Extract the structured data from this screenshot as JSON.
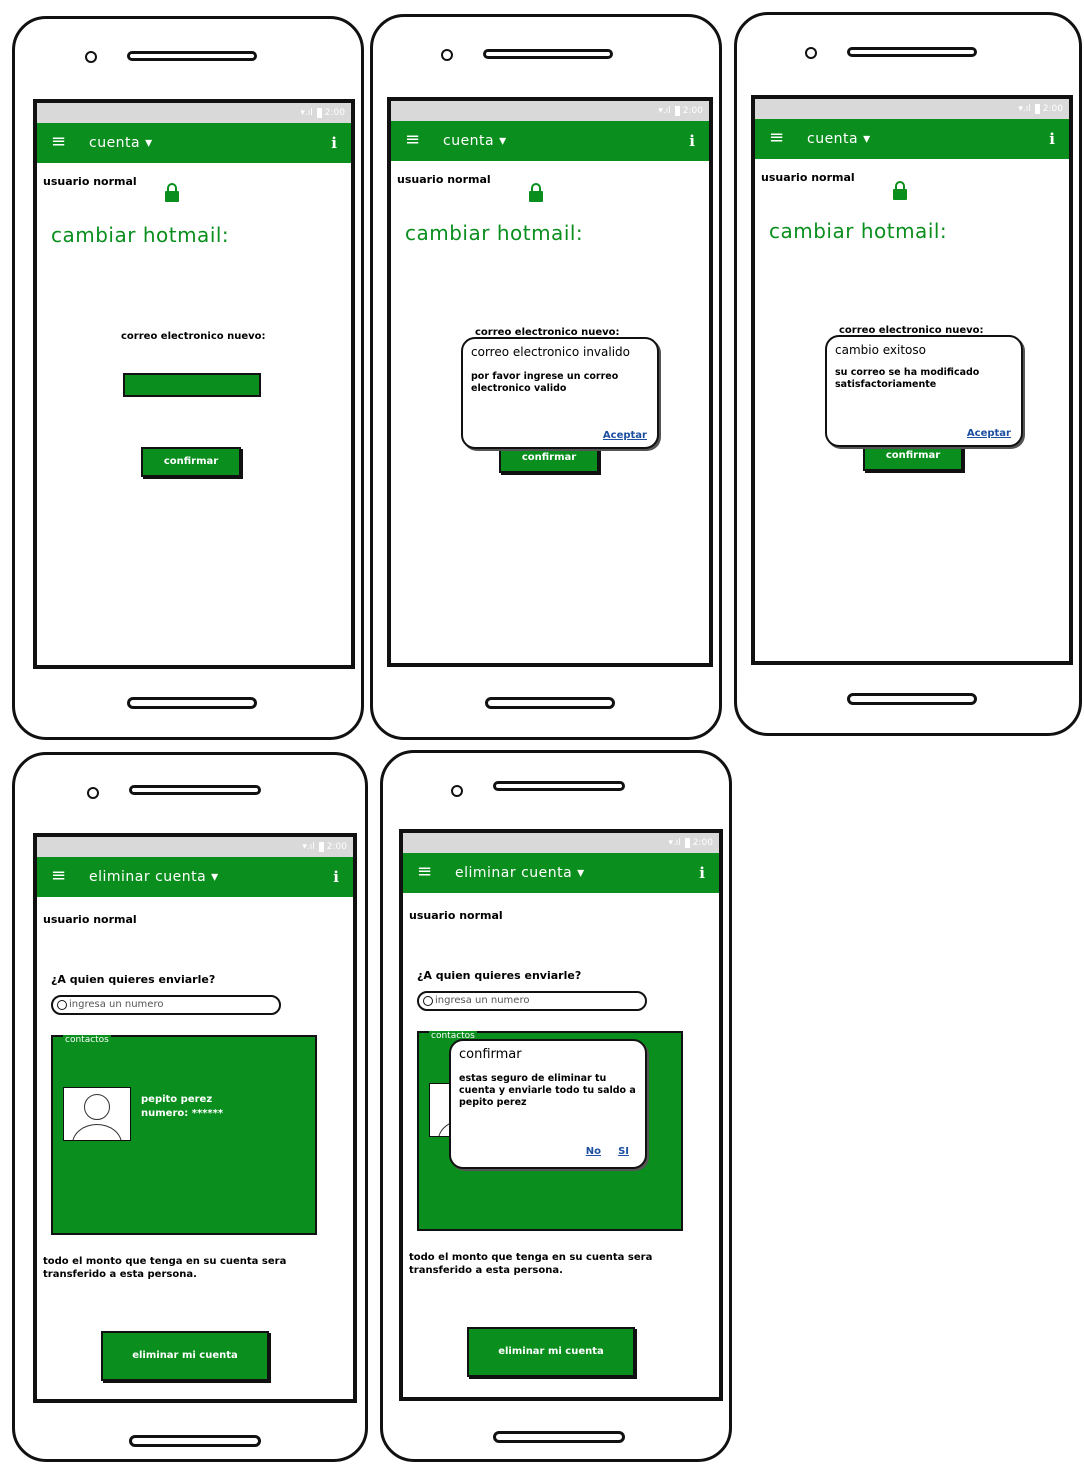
{
  "status": {
    "time": "2:00"
  },
  "screens": {
    "s1": {
      "menu_label": "cuenta ▾",
      "user": "usuario normal",
      "title": "cambiar hotmail:",
      "field_label": "correo electronico nuevo:",
      "confirm": "confirmar"
    },
    "s2": {
      "menu_label": "cuenta ▾",
      "user": "usuario normal",
      "title": "cambiar hotmail:",
      "field_label": "correo electronico nuevo:",
      "confirm": "confirmar",
      "dialog": {
        "title": "correo electronico invalido",
        "message": "por favor ingrese un correo electronico valido",
        "accept": "Aceptar"
      }
    },
    "s3": {
      "menu_label": "cuenta ▾",
      "user": "usuario normal",
      "title": "cambiar hotmail:",
      "field_label": "correo electronico nuevo:",
      "confirm": "confirmar",
      "dialog": {
        "title": "cambio exitoso",
        "message": "su correo se ha modificado satisfactoriamente",
        "accept": "Aceptar"
      }
    },
    "s4": {
      "menu_label": "eliminar cuenta ▾",
      "user": "usuario normal",
      "question": "¿A quien quieres enviarle?",
      "search_placeholder": "ingresa un numero",
      "contacts_label": "contactos",
      "contact_name": "pepito perez",
      "contact_number": "numero: ******",
      "note": "todo el monto que tenga en su cuenta sera transferido a esta persona.",
      "delete_button": "eliminar mi cuenta"
    },
    "s5": {
      "menu_label": "eliminar cuenta ▾",
      "user": "usuario normal",
      "question": "¿A quien quieres enviarle?",
      "search_placeholder": "ingresa un numero",
      "contacts_label": "contactos",
      "note": "todo el monto que tenga en su cuenta sera transferido a esta persona.",
      "delete_button": "eliminar mi cuenta",
      "dialog": {
        "title": "confirmar",
        "message": "estas seguro de eliminar tu cuenta y enviarle todo tu saldo a pepito perez",
        "no": "No",
        "yes": "SI"
      }
    }
  },
  "colors": {
    "accent": "#0a8f1e",
    "link": "#1d4fa0"
  }
}
